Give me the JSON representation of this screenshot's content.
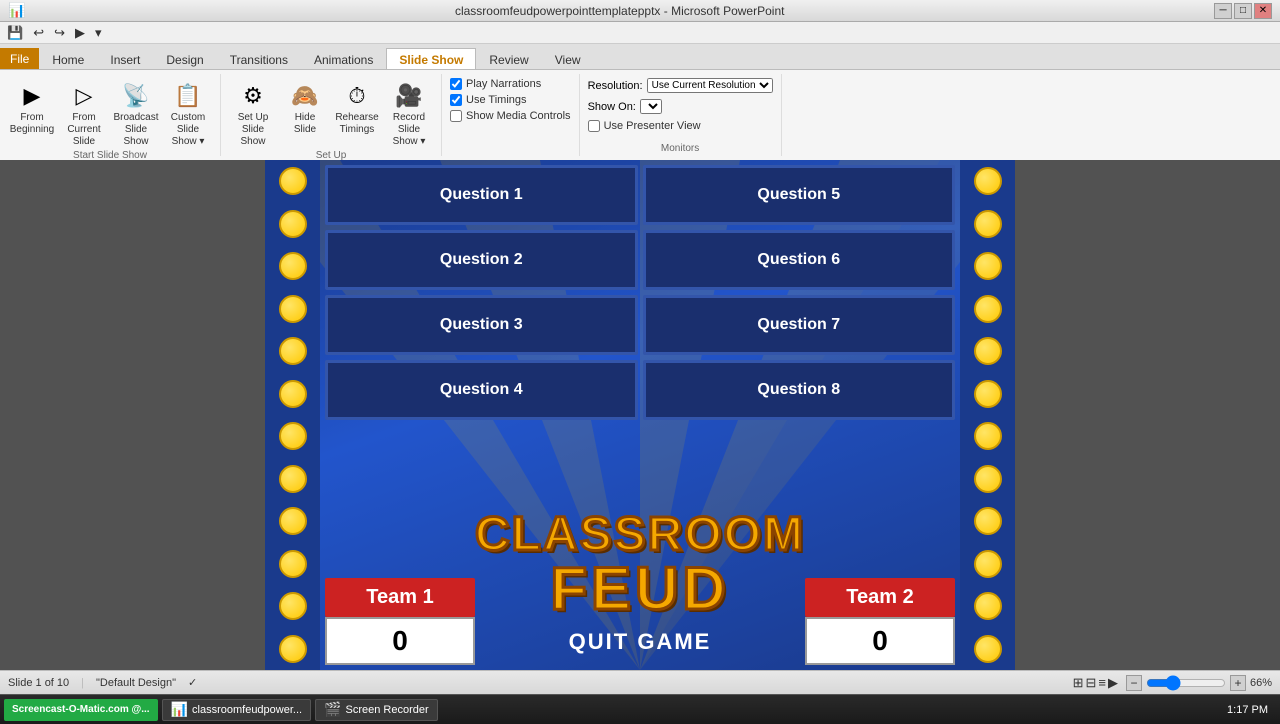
{
  "titlebar": {
    "title": "classroomfeudpowerpointtemplatepptx - Microsoft PowerPoint",
    "controls": [
      "─",
      "□",
      "✕"
    ]
  },
  "qat": {
    "buttons": [
      "💾",
      "↩",
      "↪",
      "▶"
    ]
  },
  "tabs": {
    "items": [
      "File",
      "Home",
      "Insert",
      "Design",
      "Transitions",
      "Animations",
      "Slide Show",
      "Review",
      "View"
    ],
    "active": "Slide Show"
  },
  "ribbon": {
    "groups": [
      {
        "label": "Start Slide Show",
        "buttons": [
          {
            "icon": "▶",
            "label": "From Beginning"
          },
          {
            "icon": "▷",
            "label": "From Current Slide"
          },
          {
            "icon": "📡",
            "label": "Broadcast Slide Show"
          },
          {
            "icon": "📋",
            "label": "Custom Slide Show ▾"
          }
        ]
      },
      {
        "label": "Set Up",
        "buttons": [
          {
            "icon": "⚙",
            "label": "Set Up Slide Show"
          },
          {
            "icon": "🙈",
            "label": "Hide Slide"
          },
          {
            "icon": "⏱",
            "label": "Rehearse Timings"
          },
          {
            "icon": "🎥",
            "label": "Record Slide Show ▾"
          }
        ]
      },
      {
        "label": "",
        "checkboxes": [
          "Play Narrations",
          "Use Timings",
          "Show Media Controls"
        ]
      },
      {
        "label": "Monitors",
        "resolution_label": "Resolution:",
        "resolution_value": "Use Current Resolution",
        "show_on_label": "Show On:",
        "show_on_value": "",
        "presenter_view": "Use Presenter View"
      }
    ]
  },
  "slide": {
    "questions": [
      "Question 1",
      "Question 5",
      "Question 2",
      "Question 6",
      "Question 3",
      "Question 7",
      "Question 4",
      "Question 8"
    ],
    "title_line1": "CLASSROOM",
    "title_line2": "FEUD",
    "team1_label": "Team 1",
    "team2_label": "Team 2",
    "team1_score": "0",
    "team2_score": "0",
    "quit_label": "QUIT GAME"
  },
  "statusbar": {
    "slide_info": "Slide 1 of 10",
    "theme": "\"Default Design\"",
    "spell_check": "✓",
    "zoom": "66%"
  },
  "taskbar": {
    "brand": "Screencast-O-Matic.com @...",
    "items": [
      {
        "icon": "📊",
        "label": "classroomfeudpower..."
      },
      {
        "icon": "🎬",
        "label": "Screen Recorder"
      }
    ],
    "time": "1:17 PM"
  }
}
